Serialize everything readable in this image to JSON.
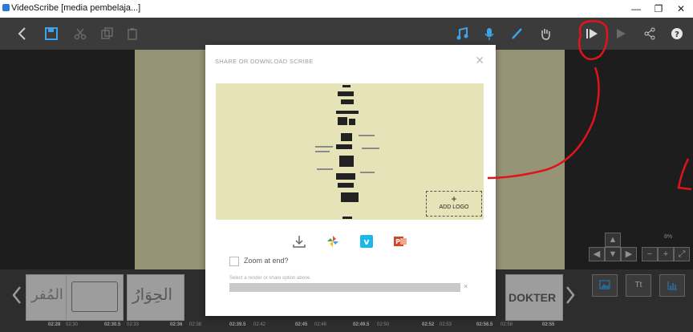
{
  "window": {
    "title": "VideoScribe [media pembelaja...]",
    "min": "—",
    "max": "❐",
    "close": "✕"
  },
  "modal": {
    "heading": "SHARE OR DOWNLOAD SCRIBE",
    "add_logo_plus": "+",
    "add_logo_label": "ADD LOGO",
    "zoom_label": "Zoom at end?",
    "hint": "Select a render or share option above.",
    "progress_clear": "×"
  },
  "nav": {
    "zoom_percent": "8%"
  },
  "timeline": {
    "thumbs": [
      "المُفر",
      "",
      "الحِوَارُ",
      "",
      "",
      "",
      "",
      "",
      "DOKTER"
    ],
    "times": [
      "02:28",
      "02:30",
      "02:30.5",
      "02:33",
      "02:36",
      "02:38",
      "02:39.5",
      "02:42",
      "02:45",
      "02:46",
      "02:49.5",
      "02:50",
      "02:52",
      "02:53",
      "02:56.5",
      "02:58",
      "02:55"
    ]
  },
  "colors": {
    "accent_blue": "#2b7bd3",
    "annotation_red": "#e0141b"
  }
}
